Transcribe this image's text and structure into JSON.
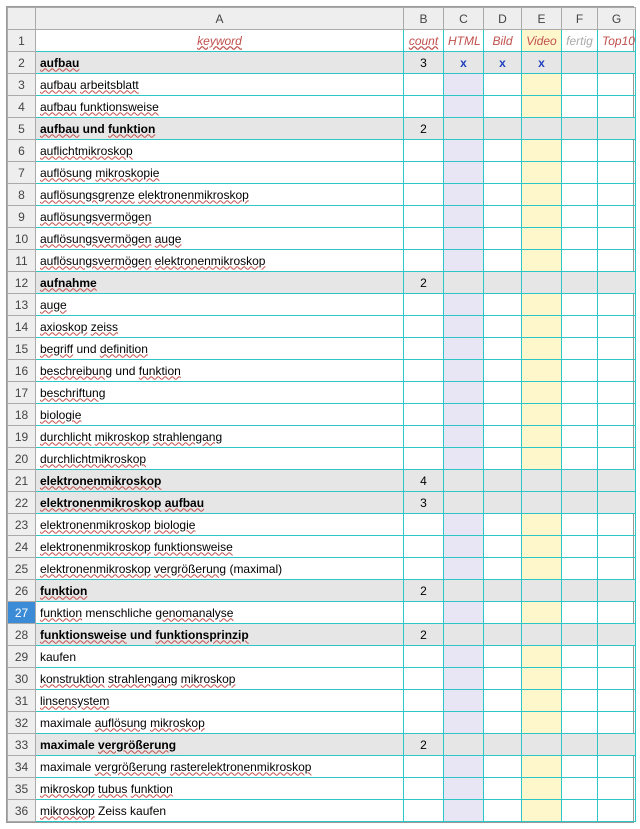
{
  "columns": {
    "A": "A",
    "B": "B",
    "C": "C",
    "D": "D",
    "E": "E",
    "F": "F",
    "G": "G"
  },
  "headerRow": {
    "num": "1",
    "keyword": "keyword",
    "count": "count",
    "html": "HTML",
    "bild": "Bild",
    "video": "Video",
    "fertig": "fertig",
    "top10": "Top10"
  },
  "selectedRow": 27,
  "rows": [
    {
      "num": "2",
      "bold": true,
      "a_parts": [
        {
          "t": "aufbau",
          "s": true
        }
      ],
      "b": "3",
      "c": "x",
      "d": "x",
      "e": "x"
    },
    {
      "num": "3",
      "bold": false,
      "a_parts": [
        {
          "t": "aufbau",
          "s": true
        },
        {
          "t": " ",
          "s": false
        },
        {
          "t": "arbeitsblatt",
          "s": true
        }
      ]
    },
    {
      "num": "4",
      "bold": false,
      "a_parts": [
        {
          "t": "aufbau",
          "s": true
        },
        {
          "t": " ",
          "s": false
        },
        {
          "t": "funktionsweise",
          "s": true
        }
      ]
    },
    {
      "num": "5",
      "bold": true,
      "a_parts": [
        {
          "t": "aufbau",
          "s": true
        },
        {
          "t": " und ",
          "s": false
        },
        {
          "t": "funktion",
          "s": true
        }
      ],
      "b": "2"
    },
    {
      "num": "6",
      "bold": false,
      "a_parts": [
        {
          "t": "auflichtmikroskop",
          "s": true
        }
      ]
    },
    {
      "num": "7",
      "bold": false,
      "a_parts": [
        {
          "t": "auflösung",
          "s": true
        },
        {
          "t": " ",
          "s": false
        },
        {
          "t": "mikroskopie",
          "s": true
        }
      ]
    },
    {
      "num": "8",
      "bold": false,
      "a_parts": [
        {
          "t": "auflösungsgrenze",
          "s": true
        },
        {
          "t": " ",
          "s": false
        },
        {
          "t": "elektronenmikroskop",
          "s": true
        }
      ]
    },
    {
      "num": "9",
      "bold": false,
      "a_parts": [
        {
          "t": "auflösungsvermögen",
          "s": true
        }
      ]
    },
    {
      "num": "10",
      "bold": false,
      "a_parts": [
        {
          "t": "auflösungsvermögen",
          "s": true
        },
        {
          "t": " ",
          "s": false
        },
        {
          "t": "auge",
          "s": true
        }
      ]
    },
    {
      "num": "11",
      "bold": false,
      "a_parts": [
        {
          "t": "auflösungsvermögen",
          "s": true
        },
        {
          "t": " ",
          "s": false
        },
        {
          "t": "elektronenmikroskop",
          "s": true
        }
      ]
    },
    {
      "num": "12",
      "bold": true,
      "a_parts": [
        {
          "t": "aufnahme",
          "s": true
        }
      ],
      "b": "2"
    },
    {
      "num": "13",
      "bold": false,
      "a_parts": [
        {
          "t": "auge",
          "s": true
        }
      ]
    },
    {
      "num": "14",
      "bold": false,
      "a_parts": [
        {
          "t": "axioskop",
          "s": true
        },
        {
          "t": " ",
          "s": false
        },
        {
          "t": "zeiss",
          "s": true
        }
      ]
    },
    {
      "num": "15",
      "bold": false,
      "a_parts": [
        {
          "t": "begriff",
          "s": true
        },
        {
          "t": " und ",
          "s": false
        },
        {
          "t": "definition",
          "s": true
        }
      ]
    },
    {
      "num": "16",
      "bold": false,
      "a_parts": [
        {
          "t": "beschreibung",
          "s": true
        },
        {
          "t": " und ",
          "s": false
        },
        {
          "t": "funktion",
          "s": true
        }
      ]
    },
    {
      "num": "17",
      "bold": false,
      "a_parts": [
        {
          "t": "beschriftung",
          "s": true
        }
      ]
    },
    {
      "num": "18",
      "bold": false,
      "a_parts": [
        {
          "t": "biologie",
          "s": true
        }
      ]
    },
    {
      "num": "19",
      "bold": false,
      "a_parts": [
        {
          "t": "durchlicht",
          "s": true
        },
        {
          "t": " ",
          "s": false
        },
        {
          "t": "mikroskop",
          "s": true
        },
        {
          "t": " ",
          "s": false
        },
        {
          "t": "strahlengang",
          "s": true
        }
      ]
    },
    {
      "num": "20",
      "bold": false,
      "a_parts": [
        {
          "t": "durchlichtmikroskop",
          "s": true
        }
      ]
    },
    {
      "num": "21",
      "bold": true,
      "a_parts": [
        {
          "t": "elektronenmikroskop",
          "s": true
        }
      ],
      "b": "4"
    },
    {
      "num": "22",
      "bold": true,
      "a_parts": [
        {
          "t": "elektronenmikroskop",
          "s": true
        },
        {
          "t": " ",
          "s": false
        },
        {
          "t": "aufbau",
          "s": true
        }
      ],
      "b": "3"
    },
    {
      "num": "23",
      "bold": false,
      "a_parts": [
        {
          "t": "elektronenmikroskop",
          "s": true
        },
        {
          "t": " ",
          "s": false
        },
        {
          "t": "biologie",
          "s": true
        }
      ]
    },
    {
      "num": "24",
      "bold": false,
      "a_parts": [
        {
          "t": "elektronenmikroskop",
          "s": true
        },
        {
          "t": " ",
          "s": false
        },
        {
          "t": "funktionsweise",
          "s": true
        }
      ]
    },
    {
      "num": "25",
      "bold": false,
      "a_parts": [
        {
          "t": "elektronenmikroskop",
          "s": true
        },
        {
          "t": " ",
          "s": false
        },
        {
          "t": "vergrößerung",
          "s": true
        },
        {
          "t": " (maximal)",
          "s": false
        }
      ]
    },
    {
      "num": "26",
      "bold": true,
      "a_parts": [
        {
          "t": "funktion",
          "s": true
        }
      ],
      "b": "2"
    },
    {
      "num": "27",
      "bold": false,
      "a_parts": [
        {
          "t": "funktion",
          "s": true
        },
        {
          "t": " menschliche ",
          "s": false
        },
        {
          "t": "genomanalyse",
          "s": true
        }
      ]
    },
    {
      "num": "28",
      "bold": true,
      "a_parts": [
        {
          "t": "funktionsweise",
          "s": true
        },
        {
          "t": " und ",
          "s": false
        },
        {
          "t": "funktionsprinzip",
          "s": true
        }
      ],
      "b": "2"
    },
    {
      "num": "29",
      "bold": false,
      "a_parts": [
        {
          "t": "kaufen",
          "s": false
        }
      ]
    },
    {
      "num": "30",
      "bold": false,
      "a_parts": [
        {
          "t": "konstruktion",
          "s": true
        },
        {
          "t": " ",
          "s": false
        },
        {
          "t": "strahlengang",
          "s": true
        },
        {
          "t": " ",
          "s": false
        },
        {
          "t": "mikroskop",
          "s": true
        }
      ]
    },
    {
      "num": "31",
      "bold": false,
      "a_parts": [
        {
          "t": "linsensystem",
          "s": true
        }
      ]
    },
    {
      "num": "32",
      "bold": false,
      "a_parts": [
        {
          "t": "maximale ",
          "s": false
        },
        {
          "t": "auflösung",
          "s": true
        },
        {
          "t": " ",
          "s": false
        },
        {
          "t": "mikroskop",
          "s": true
        }
      ]
    },
    {
      "num": "33",
      "bold": true,
      "a_parts": [
        {
          "t": "maximale ",
          "s": false
        },
        {
          "t": "vergrößerung",
          "s": true
        }
      ],
      "b": "2"
    },
    {
      "num": "34",
      "bold": false,
      "a_parts": [
        {
          "t": "maximale ",
          "s": false
        },
        {
          "t": "vergrößerung",
          "s": true
        },
        {
          "t": " ",
          "s": false
        },
        {
          "t": "rasterelektronenmikroskop",
          "s": true
        }
      ]
    },
    {
      "num": "35",
      "bold": false,
      "a_parts": [
        {
          "t": "mikroskop",
          "s": true
        },
        {
          "t": " ",
          "s": false
        },
        {
          "t": "tubus",
          "s": true
        },
        {
          "t": " ",
          "s": false
        },
        {
          "t": "funktion",
          "s": true
        }
      ]
    },
    {
      "num": "36",
      "bold": false,
      "a_parts": [
        {
          "t": "mikroskop",
          "s": true
        },
        {
          "t": " Zeiss kaufen",
          "s": false
        }
      ]
    }
  ]
}
